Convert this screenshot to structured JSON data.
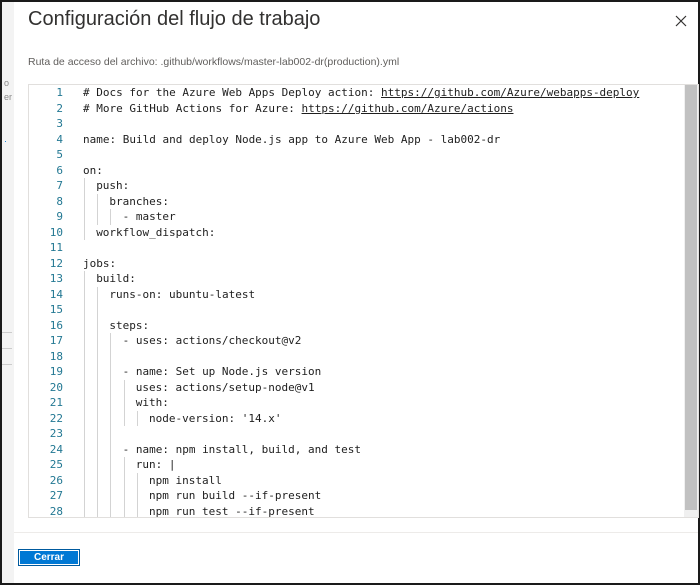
{
  "dialog": {
    "title": "Configuración del flujo de trabajo",
    "path_label": "Ruta de acceso del archivo:",
    "path_value": ".github/workflows/master-lab002-dr(production).yml",
    "close_label": "Cerrar"
  },
  "editor": {
    "lines": [
      {
        "n": "1",
        "indent": 0,
        "text": "# Docs for the Azure Web Apps Deploy action: ",
        "link": "https://github.com/Azure/webapps-deploy"
      },
      {
        "n": "2",
        "indent": 0,
        "text": "# More GitHub Actions for Azure: ",
        "link": "https://github.com/Azure/actions"
      },
      {
        "n": "3",
        "indent": 0,
        "text": "",
        "link": ""
      },
      {
        "n": "4",
        "indent": 0,
        "text": "name: Build and deploy Node.js app to Azure Web App - lab002-dr",
        "link": ""
      },
      {
        "n": "5",
        "indent": 0,
        "text": "",
        "link": ""
      },
      {
        "n": "6",
        "indent": 0,
        "text": "on:",
        "link": ""
      },
      {
        "n": "7",
        "indent": 1,
        "text": "push:",
        "link": ""
      },
      {
        "n": "8",
        "indent": 2,
        "text": "branches:",
        "link": ""
      },
      {
        "n": "9",
        "indent": 3,
        "text": "- master",
        "link": ""
      },
      {
        "n": "10",
        "indent": 1,
        "text": "workflow_dispatch:",
        "link": ""
      },
      {
        "n": "11",
        "indent": 0,
        "text": "",
        "link": ""
      },
      {
        "n": "12",
        "indent": 0,
        "text": "jobs:",
        "link": ""
      },
      {
        "n": "13",
        "indent": 1,
        "text": "build:",
        "link": ""
      },
      {
        "n": "14",
        "indent": 2,
        "text": "runs-on: ubuntu-latest",
        "link": ""
      },
      {
        "n": "15",
        "indent": 2,
        "text": "",
        "link": ""
      },
      {
        "n": "16",
        "indent": 2,
        "text": "steps:",
        "link": ""
      },
      {
        "n": "17",
        "indent": 3,
        "text": "- uses: actions/checkout@v2",
        "link": ""
      },
      {
        "n": "18",
        "indent": 3,
        "text": "",
        "link": ""
      },
      {
        "n": "19",
        "indent": 3,
        "text": "- name: Set up Node.js version",
        "link": ""
      },
      {
        "n": "20",
        "indent": 4,
        "text": "uses: actions/setup-node@v1",
        "link": ""
      },
      {
        "n": "21",
        "indent": 4,
        "text": "with:",
        "link": ""
      },
      {
        "n": "22",
        "indent": 5,
        "text": "node-version: '14.x'",
        "link": ""
      },
      {
        "n": "23",
        "indent": 3,
        "text": "",
        "link": ""
      },
      {
        "n": "24",
        "indent": 3,
        "text": "- name: npm install, build, and test",
        "link": ""
      },
      {
        "n": "25",
        "indent": 4,
        "text": "run: |",
        "link": ""
      },
      {
        "n": "26",
        "indent": 5,
        "text": "npm install",
        "link": ""
      },
      {
        "n": "27",
        "indent": 5,
        "text": "npm run build --if-present",
        "link": ""
      },
      {
        "n": "28",
        "indent": 5,
        "text": "npm run test --if-present",
        "link": ""
      }
    ]
  },
  "backdrop": {
    "fragments": [
      "o",
      "er"
    ]
  },
  "colors": {
    "primary": "#0078d4",
    "line_number": "#237893"
  },
  "icons": {
    "close": "close-icon"
  }
}
